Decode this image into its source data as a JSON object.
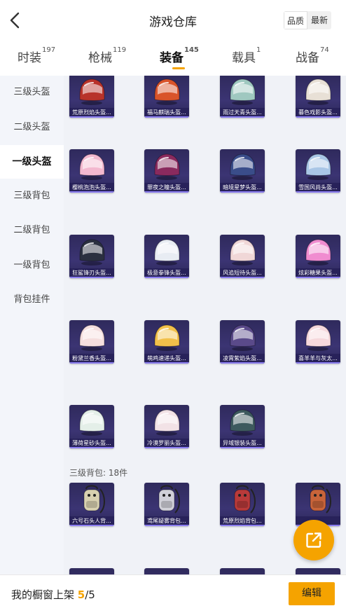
{
  "header": {
    "title": "游戏仓库",
    "sort_options": [
      "品质",
      "最新"
    ],
    "active_sort": 0
  },
  "tabs": [
    {
      "label": "时装",
      "count": "197"
    },
    {
      "label": "枪械",
      "count": "119"
    },
    {
      "label": "装备",
      "count": "145"
    },
    {
      "label": "载具",
      "count": "1"
    },
    {
      "label": "战备",
      "count": "74"
    }
  ],
  "active_tab": 2,
  "sidebar": {
    "items": [
      "三级头盔",
      "二级头盔",
      "一级头盔",
      "三级背包",
      "二级背包",
      "一级背包",
      "背包挂件"
    ],
    "active_index": 2
  },
  "helmets": [
    {
      "name": "荒原烈焰头盔...",
      "color": "#b8332a"
    },
    {
      "name": "福马麒瑞头盔...",
      "color": "#d9542a"
    },
    {
      "name": "雨过天青头盔...",
      "color": "#9fc8c0"
    },
    {
      "name": "暮色戏影头盔...",
      "color": "#e8e0d6"
    },
    {
      "name": "樱桃泡泡头盔...",
      "color": "#f3b8cf"
    },
    {
      "name": "罪夜之瞳头盔...",
      "color": "#8a2a5e"
    },
    {
      "name": "暗境星梦头盔...",
      "color": "#3a4d8a"
    },
    {
      "name": "雪国风尚头盔...",
      "color": "#a9c6e6"
    },
    {
      "name": "狂鲨锋刃头盔...",
      "color": "#2b3040"
    },
    {
      "name": "极意拳锋头盔...",
      "color": "#e8ecf3"
    },
    {
      "name": "风追短待头盔...",
      "color": "#f0d7d7"
    },
    {
      "name": "炫彩糖果头盔...",
      "color": "#f08cd0"
    },
    {
      "name": "粉黛兰香头盔...",
      "color": "#f5dede"
    },
    {
      "name": "萌鸡速递头盔...",
      "color": "#f2c04a"
    },
    {
      "name": "凌霄紫焰头盔...",
      "color": "#5a4a8a"
    },
    {
      "name": "喜羊羊与灰太...",
      "color": "#f6d8dc"
    },
    {
      "name": "薄荷星砂头盔...",
      "color": "#e4efe8"
    },
    {
      "name": "冷漠罗丽头盔...",
      "color": "#f2e2e6"
    },
    {
      "name": "异域银装头盔...",
      "color": "#3e5a5e"
    }
  ],
  "backpack_section_title": "三级背包: 18件",
  "backpacks": [
    {
      "name": "六号石头人背...",
      "color": "#d8d0b0"
    },
    {
      "name": "鸢尾疑雾背包...",
      "color": "#d0d0d8"
    },
    {
      "name": "荒原烈焰背包...",
      "color": "#b83a3a"
    },
    {
      "name": "",
      "color": "#c8643a"
    }
  ],
  "bottom": {
    "label": "我的橱窗上架",
    "count": "5",
    "total": "/5",
    "edit": "编辑"
  }
}
